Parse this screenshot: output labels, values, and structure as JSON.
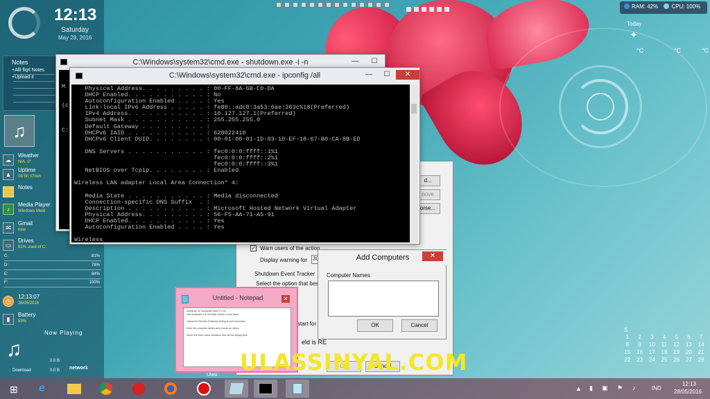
{
  "desktop": {
    "clock": {
      "time": "12:13",
      "day": "Saturday",
      "date": "May 28, 2016"
    },
    "notes": {
      "title": "Notes",
      "items": [
        "+Alll flqrl Notes",
        "+Upload it"
      ]
    },
    "widgets": {
      "weather": {
        "title": "Weather",
        "sub": "N/A, 0°"
      },
      "uptime": {
        "title": "Uptime",
        "sub": "0d 5h 37min"
      },
      "notes": {
        "title": "Notes"
      },
      "media_player": {
        "title": "Media Player",
        "sub": "Windows Medi"
      },
      "gmail": {
        "title": "Gmail",
        "sub": "new"
      },
      "drives": {
        "title": "Drives",
        "sub": "81% used of C:"
      }
    },
    "drives": [
      {
        "label": "C:",
        "pct": "81%"
      },
      {
        "label": "D:",
        "pct": "78%"
      },
      {
        "label": "E:",
        "pct": "84%"
      },
      {
        "label": "F:",
        "pct": "100%"
      }
    ],
    "clock2": {
      "time": "12:13:07",
      "date": "28/05/2016"
    },
    "battery": {
      "title": "Battery",
      "sub": "59%"
    },
    "now_playing": "Now Playing",
    "network": {
      "label": "network",
      "download": "Download",
      "download_val": "0.0 B",
      "upload_val": "0.0 B"
    },
    "sysbar": {
      "ram": "RAM: 42%",
      "cpu": "CPU: 100%"
    },
    "weather_hud": {
      "today": "Today",
      "deg1": "°C",
      "deg2": "°C",
      "deg3": "°C"
    },
    "calendar": {
      "header": "S",
      "rows": [
        [
          "1",
          "2",
          "3",
          "4",
          "5",
          "6",
          "7"
        ],
        [
          "8",
          "9",
          "10",
          "11",
          "12",
          "13",
          "14"
        ],
        [
          "15",
          "16",
          "17",
          "18",
          "19",
          "20",
          "21"
        ],
        [
          "22",
          "23",
          "24",
          "25",
          "26",
          "27",
          "28"
        ]
      ]
    }
  },
  "shutdown_window": {
    "title": "C:\\Windows\\system32\\cmd.exe - shutdown.exe  -i -n",
    "side_chars": [
      "M",
      "(c",
      "C:"
    ]
  },
  "ipconfig_window": {
    "title": "C:\\Windows\\system32\\cmd.exe - ipconfig /all",
    "lines": [
      "   Physical Address. . . . . . . . . : 00-FF-8A-6B-C0-DA",
      "   DHCP Enabled. . . . . . . . . . . : No",
      "   Autoconfiguration Enabled . . . . : Yes",
      "   Link-local IPv6 Address . . . . . : fe80::adc8:3a53:6ae:203c%18(Preferred)",
      "   IPv4 Address. . . . . . . . . . . : 10.127.127.1(Preferred)",
      "   Subnet Mask . . . . . . . . . . . : 255.255.255.0",
      "   Default Gateway . . . . . . . . . :",
      "   DHCPv6 IAID . . . . . . . . . . . : 620022410",
      "   DHCPv6 Client DUID. . . . . . . . : 00-01-00-01-1D-03-1D-EF-18-67-B0-CA-8B-ED",
      "",
      "   DNS Servers . . . . . . . . . . . : fec0:0:0:ffff::1%1",
      "                                       fec0:0:0:ffff::2%1",
      "                                       fec0:0:0:ffff::3%1",
      "   NetBIOS over Tcpip. . . . . . . . : Enabled",
      "",
      "Wireless LAN adapter Local Area Connection* 4:",
      "",
      "   Media State . . . . . . . . . . . : Media disconnected",
      "   Connection-specific DNS Suffix  . :",
      "   Description . . . . . . . . . . . : Microsoft Hosted Network Virtual Adapter",
      "   Physical Address. . . . . . . . . : 56-F5-AA-71-A5-91",
      "   DHCP Enabled. . . . . . . . . . . : Yes",
      "   Autoconfiguration Enabled . . . . : Yes",
      "",
      "Wireless"
    ]
  },
  "shutdown_dialog": {
    "btn1": "d...",
    "btn2": "nove",
    "btn3": "orse...",
    "warn_label": "Warn users of the action",
    "display_warning": "Display warning for",
    "display_value": "30",
    "tracker_title": "Shutdown Event Tracker",
    "tracker_text": "Select the option that bes",
    "restart_for": "start for",
    "field_text": "eld is RE",
    "ok": "OK",
    "cancel": "Cancel"
  },
  "add_computers": {
    "title": "Add Computers",
    "label": "Computer Names",
    "ok": "OK",
    "cancel": "Cancel"
  },
  "notepad": {
    "title": "Untitled - Notepad",
    "lines": [
      "shutdown /m \\\\computername /r /t 60",
      "Use shutdown /i to remotely restart or shut down",
      "",
      "Opens the Remote Shutdown Dialog to add computers",
      "",
      "Enter the computer names and choose an option",
      "",
      "Select the Warn users checkbox and set the display time"
    ]
  },
  "taskbar": {
    "lang": "IND",
    "time": "12:13",
    "date": "28/05/2016",
    "label": "Ulasi"
  },
  "watermark": "ULASSINYAL.COM"
}
